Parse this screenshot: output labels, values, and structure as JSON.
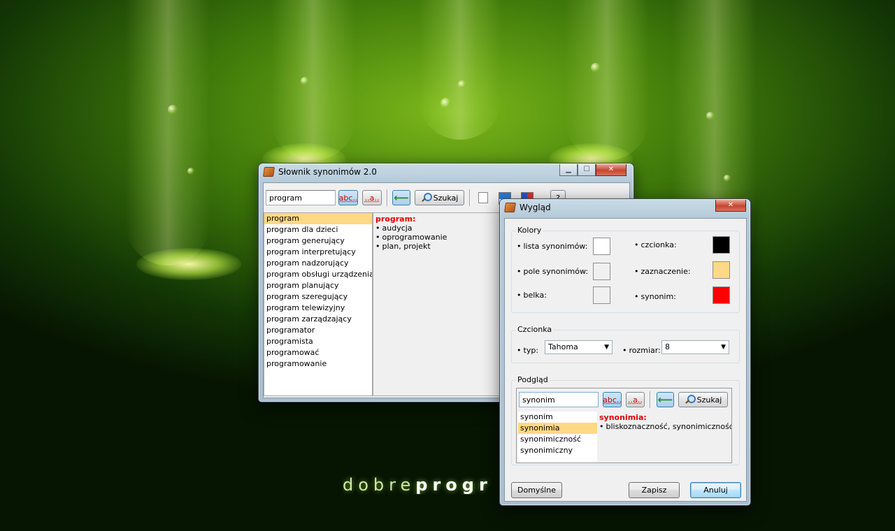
{
  "wallpaper": {
    "brand_light": "dobre",
    "brand_bold": "progr"
  },
  "main_window": {
    "title": "Słownik synonimów 2.0",
    "controls": {
      "minimize": "▁",
      "maximize": "☐",
      "close": "✕"
    },
    "toolbar": {
      "search_value": "program",
      "btn_abc": "abc..",
      "btn_dots": "..a..",
      "btn_back": "⟵",
      "btn_search": "Szukaj",
      "btn_help": "?"
    },
    "word_list": [
      "program",
      "program dla dzieci",
      "program generujący",
      "program interpretujący",
      "program nadzorujący",
      "program obsługi urządzenia",
      "program planujący",
      "program szeregujący",
      "program telewizyjny",
      "program zarządzający",
      "programator",
      "programista",
      "programować",
      "programowanie"
    ],
    "selected_index": 0,
    "definition": {
      "headword": "program:",
      "synonyms": [
        "audycja",
        "oprogramowanie",
        "plan, projekt"
      ]
    }
  },
  "dialog": {
    "title": "Wygląd",
    "close": "✕",
    "colors_group": {
      "label": "Kolory",
      "items": [
        {
          "label": "lista synonimów:",
          "color": "#ffffff"
        },
        {
          "label": "pole synonimów:",
          "color": "#f0f0f0"
        },
        {
          "label": "belka:",
          "color": "#f0f0f0"
        },
        {
          "label": "czcionka:",
          "color": "#000000"
        },
        {
          "label": "zaznaczenie:",
          "color": "#ffd983"
        },
        {
          "label": "synonim:",
          "color": "#ff0000"
        }
      ]
    },
    "font_group": {
      "label": "Czcionka",
      "type_label": "typ:",
      "type_value": "Tahoma",
      "size_label": "rozmiar:",
      "size_value": "8"
    },
    "preview_group": {
      "label": "Podgląd",
      "search_value": "synonim",
      "btn_abc": "abc..",
      "btn_dots": "..a..",
      "btn_search": "Szukaj",
      "word_list": [
        "synonim",
        "synonimia",
        "synonimiczność",
        "synonimiczny"
      ],
      "selected_index": 1,
      "definition": {
        "headword": "synonimia:",
        "synonyms": [
          "bliskoznaczność, synonimiczność"
        ]
      }
    },
    "buttons": {
      "defaults": "Domyślne",
      "save": "Zapisz",
      "cancel": "Anuluj"
    }
  }
}
